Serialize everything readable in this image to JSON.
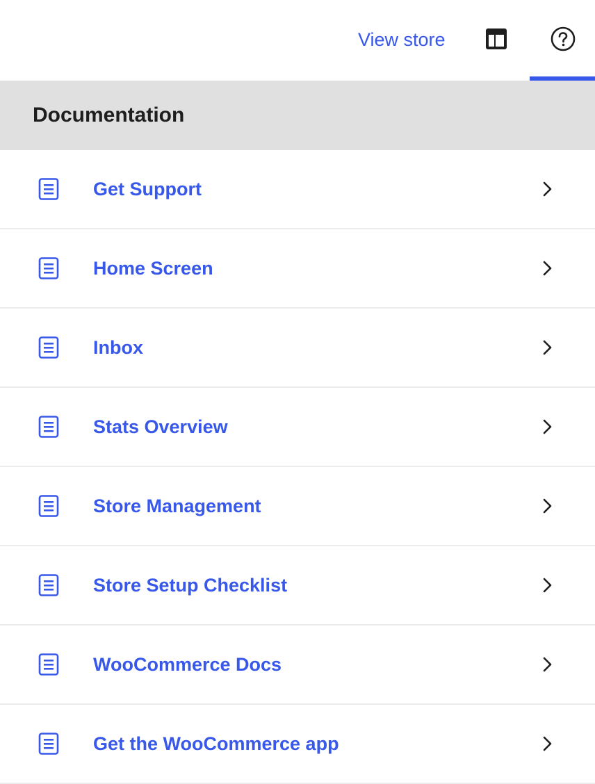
{
  "header": {
    "view_store_label": "View store",
    "layout_icon": "layout-icon",
    "help_icon": "help-icon",
    "accent_color": "#3858e9"
  },
  "section": {
    "title": "Documentation"
  },
  "docs": {
    "items": [
      {
        "label": "Get Support",
        "icon": "page-icon"
      },
      {
        "label": "Home Screen",
        "icon": "page-icon"
      },
      {
        "label": "Inbox",
        "icon": "page-icon"
      },
      {
        "label": "Stats Overview",
        "icon": "page-icon"
      },
      {
        "label": "Store Management",
        "icon": "page-icon"
      },
      {
        "label": "Store Setup Checklist",
        "icon": "page-icon"
      },
      {
        "label": "WooCommerce Docs",
        "icon": "page-icon"
      },
      {
        "label": "Get the WooCommerce app",
        "icon": "page-icon"
      }
    ]
  }
}
